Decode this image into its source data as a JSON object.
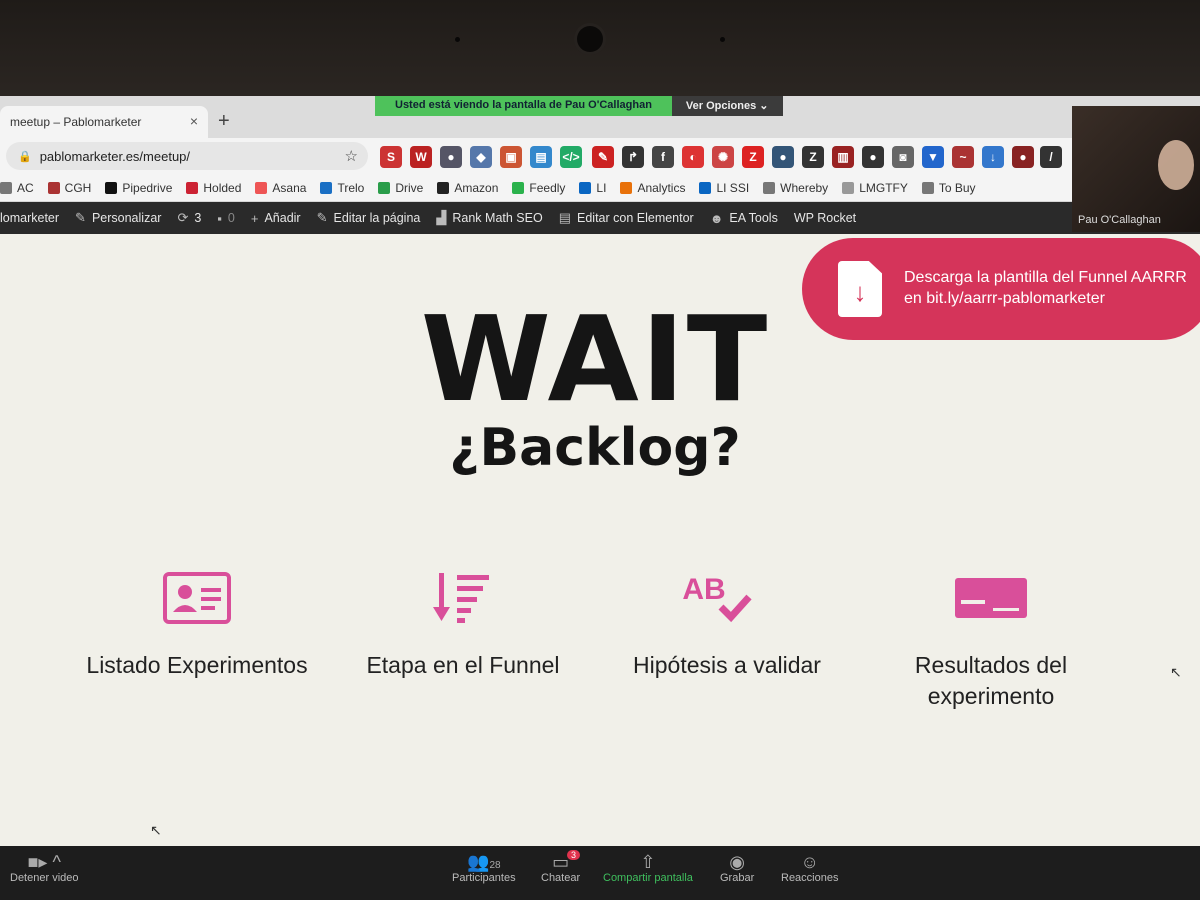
{
  "share_banner": {
    "text": "Usted está viendo la pantalla de Pau O'Callaghan",
    "options": "Ver Opciones ⌄"
  },
  "tab": {
    "title": "meetup – Pablomarketer",
    "close": "×",
    "new": "+"
  },
  "address": {
    "url": "pablomarketer.es/meetup/"
  },
  "bookmarks": [
    "AC",
    "CGH",
    "Pipedrive",
    "Holded",
    "Asana",
    "Trelo",
    "Drive",
    "Amazon",
    "Feedly",
    "LI",
    "Analytics",
    "LI SSI",
    "Whereby",
    "LMGTFY",
    "To Buy"
  ],
  "wp_bar": {
    "site": "lomarketer",
    "customize": "Personalizar",
    "updates": "3",
    "comments": "0",
    "add": "Añadir",
    "edit_page": "Editar la página",
    "rank_math": "Rank Math SEO",
    "elementor": "Editar con Elementor",
    "ea_tools": "EA Tools",
    "wp_rocket": "WP Rocket"
  },
  "video": {
    "name": "Pau O'Callaghan"
  },
  "slide": {
    "cta": "Descarga la plantilla del Funnel AARRR en bit.ly/aarrr-pablomarketer",
    "title": "WAIT",
    "subtitle": "¿Backlog?",
    "cards": [
      {
        "icon": "id-card-icon",
        "label": "Listado Experimentos"
      },
      {
        "icon": "sort-list-icon",
        "label": "Etapa en el Funnel"
      },
      {
        "icon": "ab-check-icon",
        "ab_text": "AB",
        "label": "Hipótesis a validar"
      },
      {
        "icon": "payment-card-icon",
        "label": "Resultados del experimento"
      }
    ]
  },
  "zoom": {
    "video": "Detener video",
    "participants": "Participantes",
    "participants_count": "28",
    "chat": "Chatear",
    "chat_badge": "3",
    "share": "Compartir pantalla",
    "record": "Grabar",
    "reactions": "Reacciones"
  },
  "colors": {
    "accent_pink": "#d94f9a",
    "cta_red": "#d5345a",
    "zoom_share_green": "#4ec25b"
  }
}
